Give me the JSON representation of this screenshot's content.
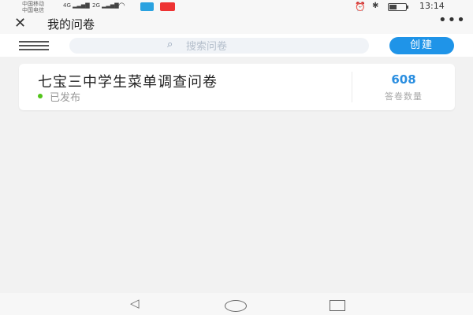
{
  "status_bar": {
    "carrier1": "中国移动",
    "carrier2": "中国电信",
    "signal1": "4G ▂▃▅▇",
    "signal2": "2G ▂▃▅▇",
    "time": "13:14"
  },
  "header": {
    "title": "我的问卷",
    "close_icon": "close-icon",
    "more_icon": "more-icon"
  },
  "toolbar": {
    "search_placeholder": "搜索问卷",
    "create_label": "创建"
  },
  "surveys": [
    {
      "title": "七宝三中学生菜单调查问卷",
      "status": "已发布",
      "status_color": "#52c41a",
      "count": "608",
      "count_label": "答卷数量"
    }
  ],
  "colors": {
    "accent": "#1f94e8",
    "count": "#2a8ee0",
    "background": "#f2f2f2"
  }
}
